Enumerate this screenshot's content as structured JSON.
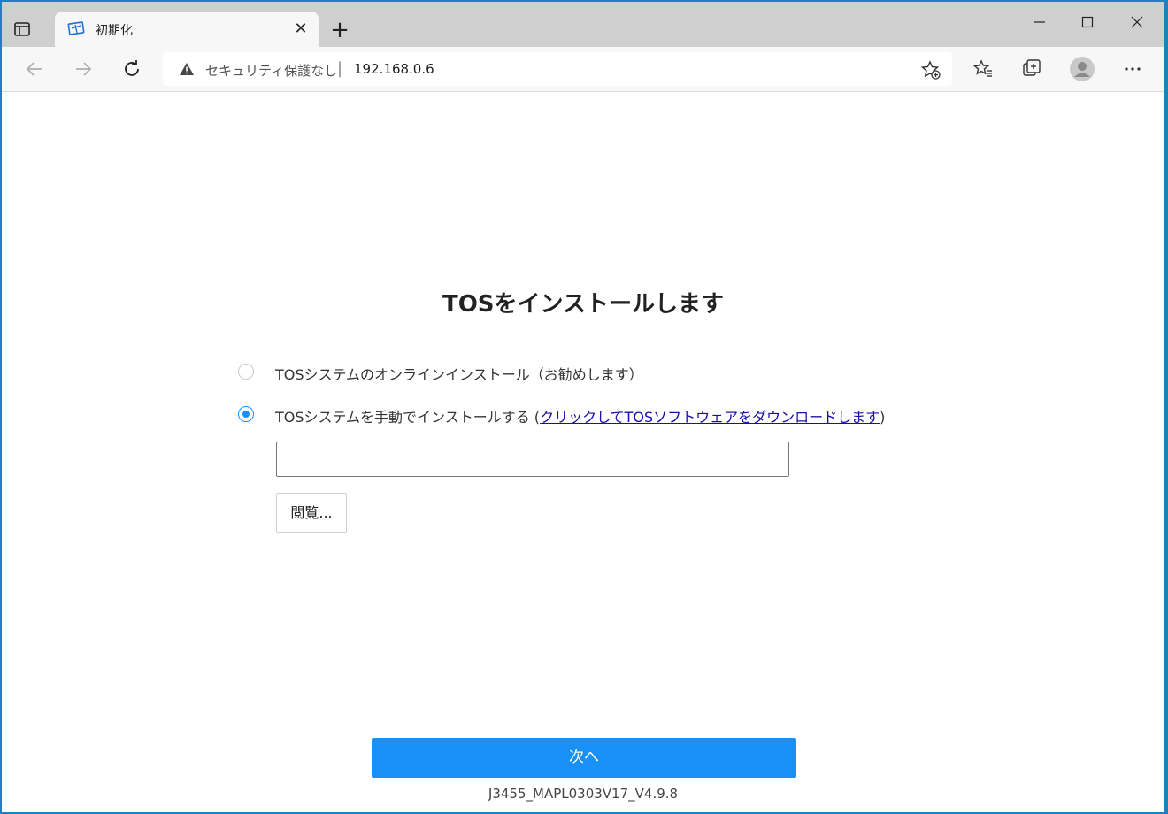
{
  "browser": {
    "tab": {
      "title": "初期化",
      "close_glyph": "✕"
    },
    "new_tab_glyph": "+",
    "window_controls": {
      "minimize": "—",
      "maximize": "☐",
      "close": "✕"
    },
    "address_bar": {
      "security_label": "セキュリティ保護なし",
      "separator": "|",
      "url": "192.168.0.6"
    },
    "icons": [
      "tab-actions-icon",
      "back-icon",
      "forward-icon",
      "refresh-icon",
      "warning-icon",
      "add-favorite-icon",
      "favorites-icon",
      "collections-icon",
      "profile-icon",
      "more-icon"
    ]
  },
  "page": {
    "heading": "TOSをインストールします",
    "options": [
      {
        "label": "TOSシステムのオンラインインストール（お勧めします）",
        "checked": false
      },
      {
        "label": "TOSシステムを手動でインストールする (",
        "link": "クリックしてTOSソフトウェアをダウンロードします",
        "suffix": ")",
        "checked": true
      }
    ],
    "file_input": {
      "value": ""
    },
    "browse_button": "閲覧...",
    "next_button": "次へ",
    "version": "J3455_MAPL0303V17_V4.9.8"
  },
  "colors": {
    "accent": "#1890f5",
    "link": "#1a0dab",
    "tabbar": "#cfcfcf"
  }
}
